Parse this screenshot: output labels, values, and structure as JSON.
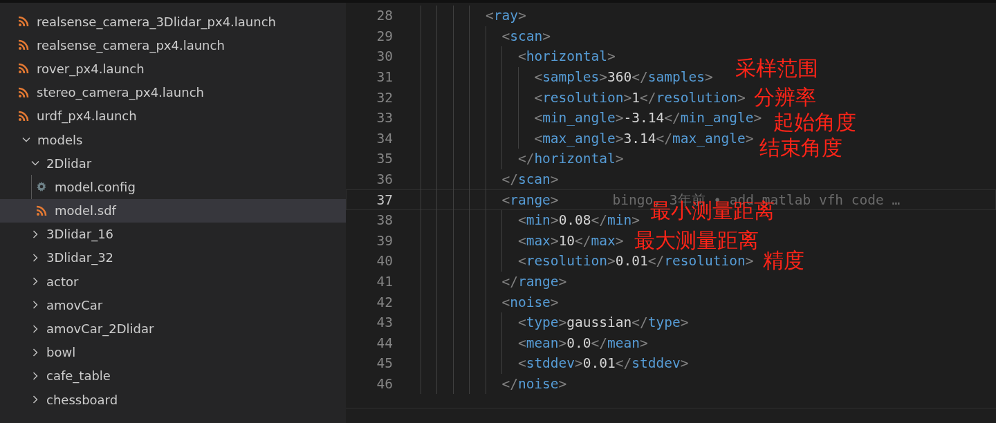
{
  "explorer": {
    "items": [
      {
        "kind": "xml-file",
        "label": "realsense_camera_3Dlidar_px4.launch",
        "selected": false
      },
      {
        "kind": "xml-file",
        "label": "realsense_camera_px4.launch",
        "selected": false
      },
      {
        "kind": "xml-file",
        "label": "rover_px4.launch",
        "selected": false
      },
      {
        "kind": "xml-file",
        "label": "stereo_camera_px4.launch",
        "selected": false
      },
      {
        "kind": "xml-file",
        "label": "urdf_px4.launch",
        "selected": false
      },
      {
        "kind": "folder",
        "label": "models",
        "expanded": true,
        "selected": false,
        "children": [
          {
            "kind": "folder",
            "label": "2Dlidar",
            "expanded": true,
            "selected": false,
            "children": [
              {
                "kind": "settings-file",
                "label": "model.config",
                "selected": false
              },
              {
                "kind": "xml-file",
                "label": "model.sdf",
                "selected": true
              }
            ]
          },
          {
            "kind": "folder",
            "label": "3Dlidar_16",
            "expanded": false,
            "selected": false
          },
          {
            "kind": "folder",
            "label": "3Dlidar_32",
            "expanded": false,
            "selected": false
          },
          {
            "kind": "folder",
            "label": "actor",
            "expanded": false,
            "selected": false
          },
          {
            "kind": "folder",
            "label": "amovCar",
            "expanded": false,
            "selected": false
          },
          {
            "kind": "folder",
            "label": "amovCar_2Dlidar",
            "expanded": false,
            "selected": false
          },
          {
            "kind": "folder",
            "label": "bowl",
            "expanded": false,
            "selected": false
          },
          {
            "kind": "folder",
            "label": "cafe_table",
            "expanded": false,
            "selected": false
          },
          {
            "kind": "folder",
            "label": "chessboard",
            "expanded": false,
            "selected": false
          }
        ]
      }
    ]
  },
  "editor": {
    "lines": [
      {
        "number": "28",
        "code": "        <ray>",
        "current": false
      },
      {
        "number": "29",
        "code": "          <scan>",
        "current": false
      },
      {
        "number": "30",
        "code": "            <horizontal>",
        "current": false
      },
      {
        "number": "31",
        "code": "              <samples>360</samples>",
        "current": false
      },
      {
        "number": "32",
        "code": "              <resolution>1</resolution>",
        "current": false
      },
      {
        "number": "33",
        "code": "              <min_angle>-3.14</min_angle>",
        "current": false
      },
      {
        "number": "34",
        "code": "              <max_angle>3.14</max_angle>",
        "current": false
      },
      {
        "number": "35",
        "code": "            </horizontal>",
        "current": false
      },
      {
        "number": "36",
        "code": "          </scan>",
        "current": false
      },
      {
        "number": "37",
        "code": "          <range>",
        "current": true,
        "blame": "bingo, 3年前 • add matlab vfh code …"
      },
      {
        "number": "38",
        "code": "            <min>0.08</min>",
        "current": false
      },
      {
        "number": "39",
        "code": "            <max>10</max>",
        "current": false
      },
      {
        "number": "40",
        "code": "            <resolution>0.01</resolution>",
        "current": false
      },
      {
        "number": "41",
        "code": "          </range>",
        "current": false
      },
      {
        "number": "42",
        "code": "          <noise>",
        "current": false
      },
      {
        "number": "43",
        "code": "            <type>gaussian</type>",
        "current": false
      },
      {
        "number": "44",
        "code": "            <mean>0.0</mean>",
        "current": false
      },
      {
        "number": "45",
        "code": "            <stddev>0.01</stddev>",
        "current": false
      },
      {
        "number": "46",
        "code": "          </noise>",
        "current": false
      }
    ],
    "annotations": [
      {
        "text": "采样范围"
      },
      {
        "text": "分辨率"
      },
      {
        "text": "起始角度"
      },
      {
        "text": "结束角度"
      },
      {
        "text": "最小测量距离"
      },
      {
        "text": "最大测量距离"
      },
      {
        "text": "精度"
      }
    ]
  }
}
